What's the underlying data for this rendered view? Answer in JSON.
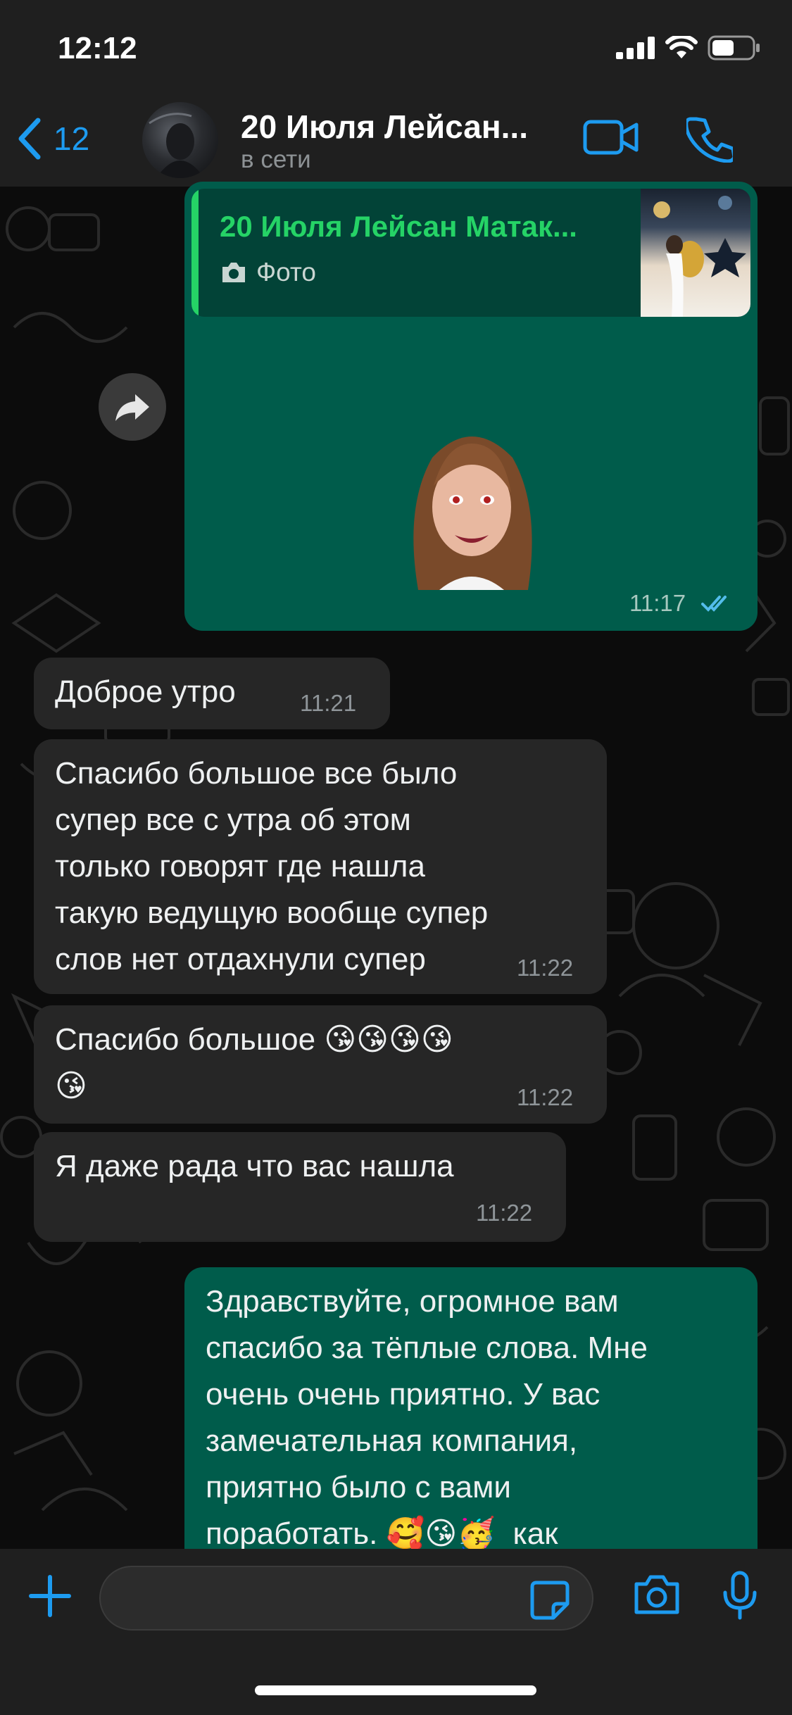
{
  "status_bar": {
    "time": "12:12"
  },
  "header": {
    "back_count": "12",
    "contact_name": "20 Июля Лейсан...",
    "contact_status": "в сети"
  },
  "messages": [
    {
      "direction": "out",
      "quote": {
        "name": "20 Июля Лейсан Матак...",
        "type": "Фото"
      },
      "content": "sticker",
      "time": "11:17",
      "read": true
    },
    {
      "direction": "in",
      "text": "Доброе утро",
      "time": "11:21"
    },
    {
      "direction": "in",
      "text": "Спасибо большое все было\nсупер все с утра об этом\nтолько говорят где нашла\nтакую ведущую вообще супер\nслов нет отдахнули супер",
      "time": "11:22"
    },
    {
      "direction": "in",
      "text": "Спасибо большое 😘😘😘😘\n😘",
      "time": "11:22"
    },
    {
      "direction": "in",
      "text": "Я даже рада что вас нашла",
      "time": "11:22"
    },
    {
      "direction": "out",
      "text": "Здравствуйте, огромное вам\nспасибо за тёплые слова. Мне\nочень очень приятно. У вас\nзамечательная компания,\nприятно было с вами\nпоработать. 🥰😘🥳  как"
    }
  ],
  "colors": {
    "accent": "#1d9bf0",
    "outgoing_bubble": "#005c4b",
    "incoming_bubble": "#262626",
    "quote_name": "#25d366"
  },
  "icons": [
    "back-chevron-icon",
    "video-call-icon",
    "phone-icon",
    "camera-icon",
    "forward-icon",
    "plus-icon",
    "sticker-icon",
    "microphone-icon",
    "double-check-icon"
  ]
}
